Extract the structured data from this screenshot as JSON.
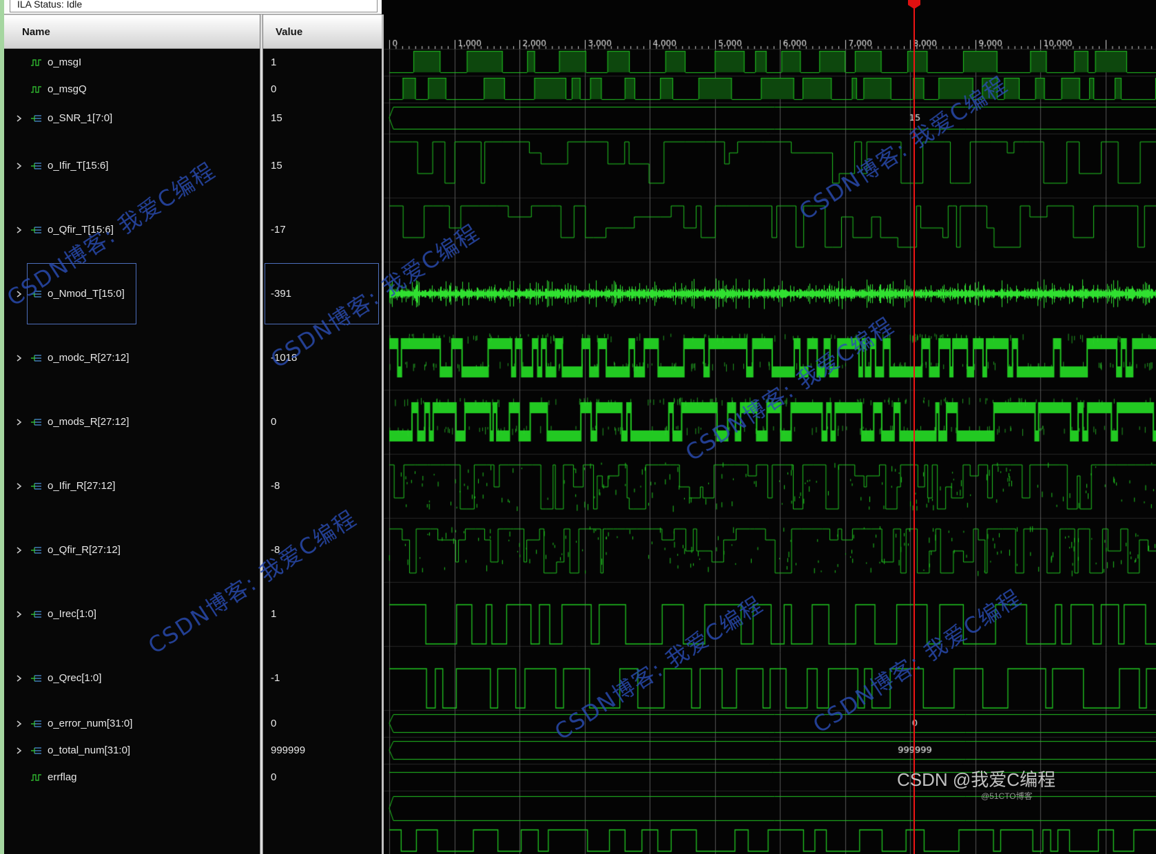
{
  "status_bar": {
    "text": "ILA Status: Idle"
  },
  "columns": {
    "name_header": "Name",
    "value_header": "Value"
  },
  "signals": [
    {
      "name": "o_msgI",
      "value": "1",
      "icon": "scalar",
      "expandable": false,
      "selected": false,
      "wave": "digital"
    },
    {
      "name": "o_msgQ",
      "value": "0",
      "icon": "scalar",
      "expandable": false,
      "selected": false,
      "wave": "digital"
    },
    {
      "name": "o_SNR_1[7:0]",
      "value": "15",
      "icon": "bus",
      "expandable": true,
      "selected": false,
      "wave": "bus",
      "wave_label": "15"
    },
    {
      "name": "o_Ifir_T[15:6]",
      "value": "15",
      "icon": "bus",
      "expandable": true,
      "selected": false,
      "wave": "steps"
    },
    {
      "name": "o_Qfir_T[15:6]",
      "value": "-17",
      "icon": "bus",
      "expandable": true,
      "selected": false,
      "wave": "steps"
    },
    {
      "name": "o_Nmod_T[15:0]",
      "value": "-391",
      "icon": "bus",
      "expandable": true,
      "selected": true,
      "wave": "noise"
    },
    {
      "name": "o_modc_R[27:12]",
      "value": "-1018",
      "icon": "bus",
      "expandable": true,
      "selected": false,
      "wave": "blocky"
    },
    {
      "name": "o_mods_R[27:12]",
      "value": "0",
      "icon": "bus",
      "expandable": true,
      "selected": false,
      "wave": "blocky"
    },
    {
      "name": "o_Ifir_R[27:12]",
      "value": "-8",
      "icon": "bus",
      "expandable": true,
      "selected": false,
      "wave": "noisysteps"
    },
    {
      "name": "o_Qfir_R[27:12]",
      "value": "-8",
      "icon": "bus",
      "expandable": true,
      "selected": false,
      "wave": "noisysteps"
    },
    {
      "name": "o_Irec[1:0]",
      "value": "1",
      "icon": "bus",
      "expandable": true,
      "selected": false,
      "wave": "digital2"
    },
    {
      "name": "o_Qrec[1:0]",
      "value": "-1",
      "icon": "bus",
      "expandable": true,
      "selected": false,
      "wave": "digital2"
    },
    {
      "name": "o_error_num[31:0]",
      "value": "0",
      "icon": "bus",
      "expandable": true,
      "selected": false,
      "wave": "bus",
      "wave_label": "0"
    },
    {
      "name": "o_total_num[31:0]",
      "value": "999999",
      "icon": "bus",
      "expandable": true,
      "selected": false,
      "wave": "bus",
      "wave_label": "999999"
    },
    {
      "name": "errflag",
      "value": "0",
      "icon": "scalar",
      "expandable": false,
      "selected": false,
      "wave": "flat"
    }
  ],
  "timeline": {
    "tick_labels": [
      "0",
      "1,000",
      "2,000",
      "3,000",
      "4,000",
      "5,000",
      "6,000",
      "7,000",
      "8,000",
      "9,000",
      "10,000"
    ]
  },
  "watermark": {
    "diagonal_text": "CSDN博客: 我爱C编程",
    "bottom_text": "CSDN @我爱C编程",
    "bottom_subtext": "@51CTO博客"
  },
  "colors": {
    "wave_green": "#22c922",
    "wave_bright": "#30e030",
    "wave_fill": "#0d470d",
    "grid_line": "#555555",
    "cursor_red": "#f01414",
    "selection_blue": "#4d6fbc",
    "watermark_blue": "#2a4cb2"
  }
}
